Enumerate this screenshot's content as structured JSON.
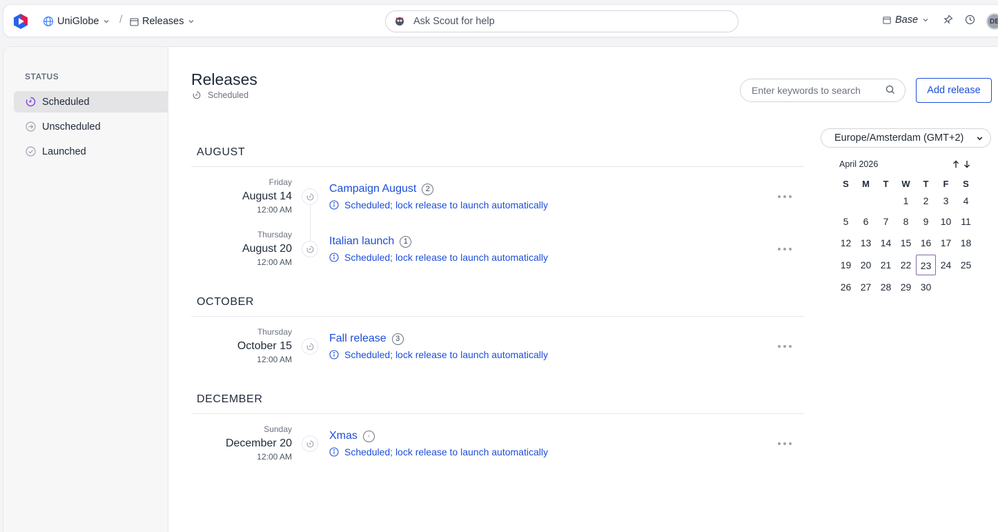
{
  "topbar": {
    "workspace": "UniGlobe",
    "section": "Releases",
    "scout_label": "Ask Scout for help",
    "base_label": "Base",
    "avatar_initials": "DE",
    "accent_color": "#1d4ed8"
  },
  "sidebar": {
    "title": "STATUS",
    "items": [
      {
        "label": "Scheduled",
        "icon": "scheduled-icon",
        "active": true
      },
      {
        "label": "Unscheduled",
        "icon": "arrow-circle-icon",
        "active": false
      },
      {
        "label": "Launched",
        "icon": "check-circle-icon",
        "active": false
      }
    ]
  },
  "main": {
    "title": "Releases",
    "subtitle": "Scheduled",
    "search_placeholder": "Enter keywords to search",
    "add_label": "Add release"
  },
  "groups": [
    {
      "month": "AUGUST",
      "releases": [
        {
          "weekday": "Friday",
          "date": "August 14",
          "time": "12:00 AM",
          "name": "Campaign August",
          "count": "2",
          "note": "Scheduled; lock release to launch automatically"
        },
        {
          "weekday": "Thursday",
          "date": "August 20",
          "time": "12:00 AM",
          "name": "Italian launch",
          "count": "1",
          "note": "Scheduled; lock release to launch automatically"
        }
      ]
    },
    {
      "month": "OCTOBER",
      "releases": [
        {
          "weekday": "Thursday",
          "date": "October 15",
          "time": "12:00 AM",
          "name": "Fall release",
          "count": "3",
          "note": "Scheduled; lock release to launch automatically"
        }
      ]
    },
    {
      "month": "DECEMBER",
      "releases": [
        {
          "weekday": "Sunday",
          "date": "December 20",
          "time": "12:00 AM",
          "name": "Xmas",
          "count": "·",
          "note": "Scheduled; lock release to launch automatically"
        }
      ]
    }
  ],
  "calendar": {
    "timezone": "Europe/Amsterdam (GMT+2)",
    "month_label": "April 2026",
    "weekdays": [
      "S",
      "M",
      "T",
      "W",
      "T",
      "F",
      "S"
    ],
    "weeks": [
      [
        "",
        "",
        "",
        "1",
        "2",
        "3",
        "4"
      ],
      [
        "5",
        "6",
        "7",
        "8",
        "9",
        "10",
        "11"
      ],
      [
        "12",
        "13",
        "14",
        "15",
        "16",
        "17",
        "18"
      ],
      [
        "19",
        "20",
        "21",
        "22",
        "23",
        "24",
        "25"
      ],
      [
        "26",
        "27",
        "28",
        "29",
        "30",
        "",
        ""
      ]
    ],
    "today": "23"
  }
}
